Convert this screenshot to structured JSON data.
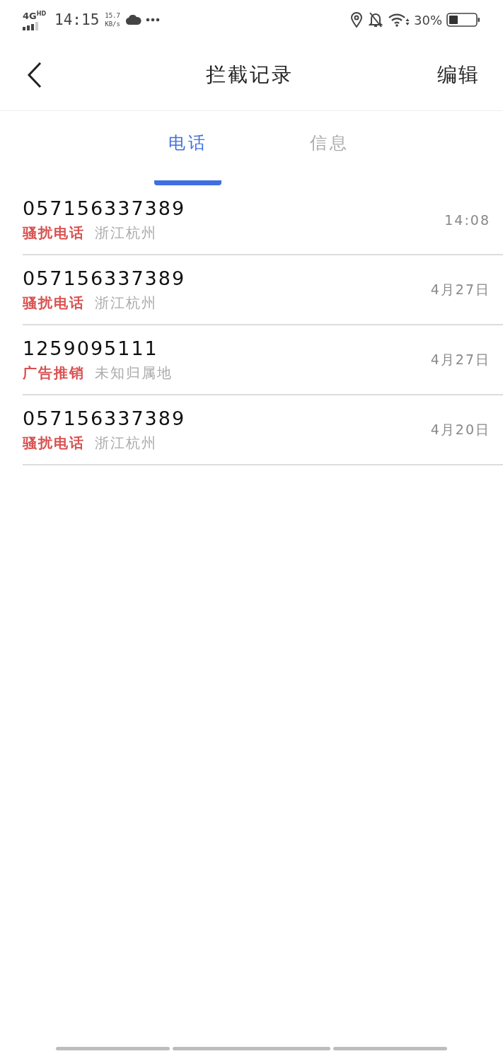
{
  "status_bar": {
    "network": "4G",
    "network_sub": "HD",
    "time": "14:15",
    "speed": "15.7",
    "speed_unit": "KB/s",
    "battery": "30%"
  },
  "header": {
    "title": "拦截记录",
    "action": "编辑"
  },
  "tabs": [
    {
      "label": "电话",
      "selected": true
    },
    {
      "label": "信息",
      "selected": false
    }
  ],
  "calls": [
    {
      "number": "057156337389",
      "tag": "骚扰电话",
      "location": "浙江杭州",
      "time": "14:08"
    },
    {
      "number": "057156337389",
      "tag": "骚扰电话",
      "location": "浙江杭州",
      "time": "4月27日"
    },
    {
      "number": "1259095111",
      "tag": "广告推销",
      "location": "未知归属地",
      "time": "4月27日"
    },
    {
      "number": "057156337389",
      "tag": "骚扰电话",
      "location": "浙江杭州",
      "time": "4月20日"
    }
  ]
}
